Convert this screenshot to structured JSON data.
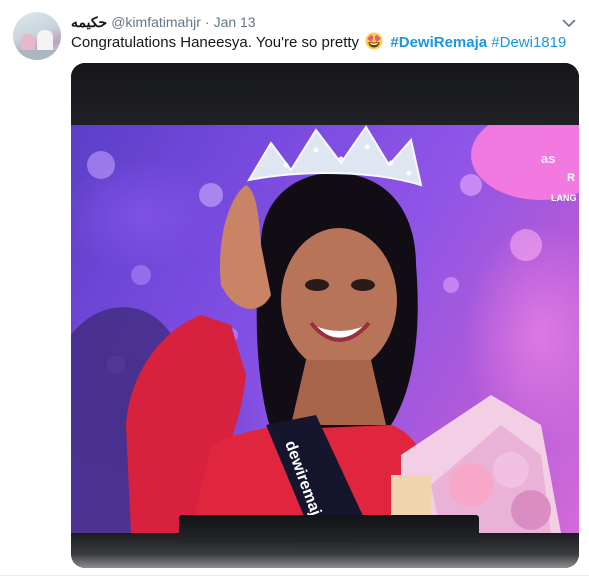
{
  "tweet": {
    "display_name": "حكيمه",
    "handle": "@kimfatimahjr",
    "separator": "·",
    "date": "Jan 13",
    "text": "Congratulations Haneesya. You're so pretty",
    "emoji": "heart-eyes-emoji",
    "hashtags": [
      {
        "text": "#DewiRemaja",
        "bold": true
      },
      {
        "text": "#Dewi1819",
        "bold": false
      }
    ]
  },
  "photo": {
    "overlay_text_1": "as",
    "overlay_text_2": "R",
    "overlay_text_3": "LANG",
    "sash_text": "dewiremaja"
  },
  "colors": {
    "link": "#1b95e0",
    "text": "#14171a",
    "muted": "#657786"
  },
  "icons": {
    "menu": "chevron-down-icon"
  }
}
